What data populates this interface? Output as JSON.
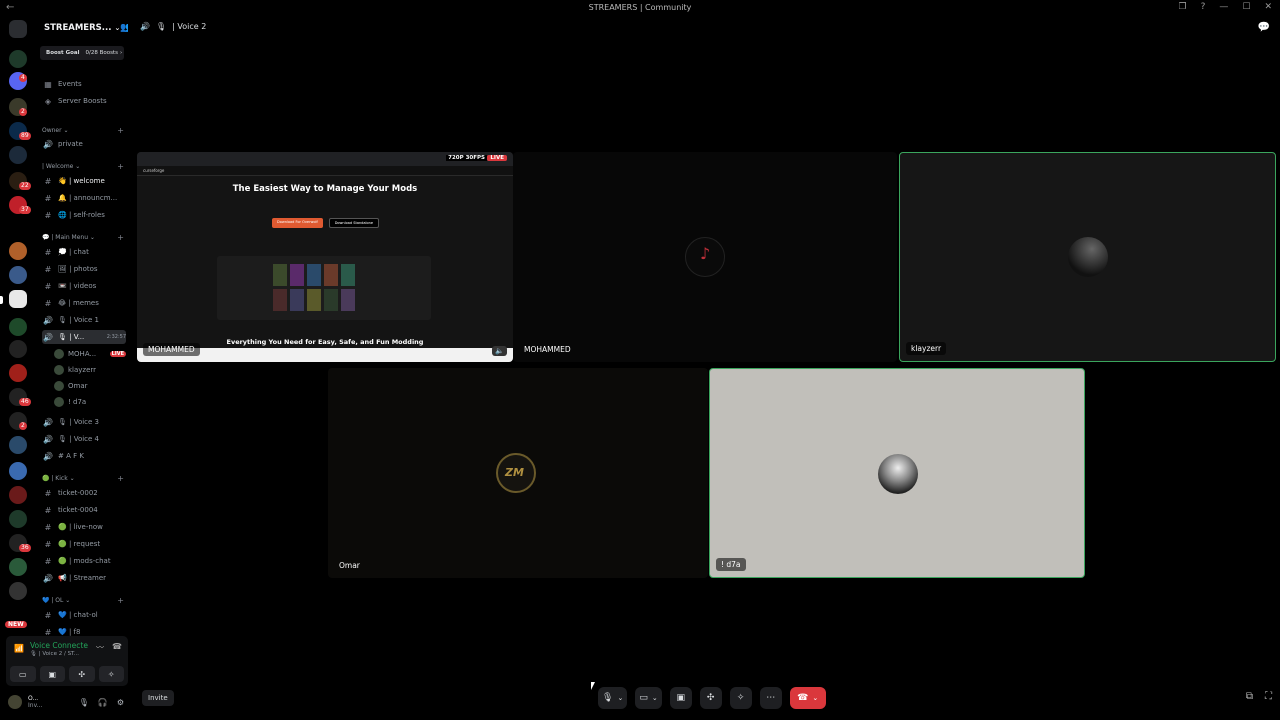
{
  "window": {
    "title": "STREAMERS | Community",
    "controls": [
      "❐",
      "?",
      "—",
      "☐",
      "✕"
    ]
  },
  "server": {
    "name": "STREAMERS...",
    "boost_goal_label": "Boost Goal",
    "boost_progress": "0/28 Boosts"
  },
  "rail": {
    "badges": [
      "4",
      "2",
      "89",
      "22",
      "37",
      "46",
      "2",
      "36"
    ],
    "new_label": "NEW"
  },
  "sidebar": {
    "items": [
      {
        "icon": "calendar-icon",
        "glyph": "▦",
        "label": "Events"
      },
      {
        "icon": "boost-icon",
        "glyph": "◈",
        "label": "Server Boosts"
      },
      {
        "icon": "",
        "glyph": "",
        "label": "Owner ⌄",
        "type": "cat"
      },
      {
        "icon": "speaker-icon",
        "glyph": "🔊",
        "label": "private"
      },
      {
        "icon": "",
        "glyph": "",
        "label": "| Welcome ⌄",
        "type": "cat"
      },
      {
        "icon": "hash-icon",
        "glyph": "#",
        "label": "👋 | welcome",
        "bright": true
      },
      {
        "icon": "hash-icon",
        "glyph": "#",
        "label": "🔔 | announcm..."
      },
      {
        "icon": "hash-icon",
        "glyph": "#",
        "label": "🌐 | self-roles"
      },
      {
        "icon": "",
        "glyph": "",
        "label": "💬 | Main Menu ⌄",
        "type": "cat"
      },
      {
        "icon": "hash-icon",
        "glyph": "#",
        "label": "💭 | chat"
      },
      {
        "icon": "hash-icon",
        "glyph": "#",
        "label": "🖼 | photos"
      },
      {
        "icon": "hash-icon",
        "glyph": "#",
        "label": "📼 | videos"
      },
      {
        "icon": "hash-icon",
        "glyph": "#",
        "label": "😂 | memes"
      },
      {
        "icon": "speaker-icon",
        "glyph": "🔊",
        "label": "🎙 | Voice 1"
      },
      {
        "icon": "speaker-icon",
        "glyph": "🔊",
        "label": "🎙 | V...",
        "active": true,
        "timer": "2:32:57"
      },
      {
        "icon": "",
        "glyph": "",
        "label": "MOHA...",
        "type": "user",
        "live": "LIVE"
      },
      {
        "icon": "",
        "glyph": "",
        "label": "klayzerr",
        "type": "user"
      },
      {
        "icon": "",
        "glyph": "",
        "label": "Omar",
        "type": "user"
      },
      {
        "icon": "",
        "glyph": "",
        "label": "! d7a",
        "type": "user"
      },
      {
        "icon": "speaker-icon",
        "glyph": "🔊",
        "label": "🎙 | Voice 3"
      },
      {
        "icon": "speaker-icon",
        "glyph": "🔊",
        "label": "🎙 | Voice 4"
      },
      {
        "icon": "speaker-icon",
        "glyph": "🔊",
        "label": "# A F K"
      },
      {
        "icon": "",
        "glyph": "",
        "label": "🟢 | Kick ⌄",
        "type": "cat"
      },
      {
        "icon": "hash-icon",
        "glyph": "#",
        "label": "ticket-0002"
      },
      {
        "icon": "hash-icon",
        "glyph": "#",
        "label": "ticket-0004"
      },
      {
        "icon": "hash-icon",
        "glyph": "#",
        "label": "🟢 | live-now"
      },
      {
        "icon": "hash-icon",
        "glyph": "#",
        "label": "🟢 | request"
      },
      {
        "icon": "hash-icon",
        "glyph": "#",
        "label": "🟢 | mods-chat"
      },
      {
        "icon": "speaker-icon",
        "glyph": "🔊",
        "label": "📢 | Streamer"
      },
      {
        "icon": "",
        "glyph": "",
        "label": "💙 | OL ⌄",
        "type": "cat"
      },
      {
        "icon": "hash-icon",
        "glyph": "#",
        "label": "💙 | chat-ol"
      },
      {
        "icon": "hash-icon",
        "glyph": "#",
        "label": "💙 | f8"
      }
    ]
  },
  "voice_panel": {
    "status": "Voice Connecte",
    "channel": "🎙 | Voice 2 / ST..."
  },
  "user_panel": {
    "name": "O...",
    "status": "Inv..."
  },
  "stage": {
    "channel_label": "| Voice 2",
    "tiles": [
      {
        "name": "MOHAMMED",
        "type": "screenshare"
      },
      {
        "name": "MOHAMMED",
        "type": "camera"
      },
      {
        "name": "klayzerr",
        "type": "camera",
        "speaking": true
      },
      {
        "name": "Omar",
        "type": "camera"
      },
      {
        "name": "! d7a",
        "type": "camera",
        "speaking": true
      }
    ],
    "screenshare": {
      "resolution": "720P 30FPS",
      "live": "LIVE",
      "brand": "curseforge",
      "headline": "The Easiest Way to Manage Your Mods",
      "primary_btn": "Download For Overwolf",
      "secondary_btn": "Download Standalone",
      "subline": "Everything You Need for Easy, Safe, and Fun Modding"
    }
  },
  "bottom": {
    "invite_label": "Invite"
  },
  "colors": {
    "accent_green": "#3ba55d",
    "danger": "#da373c",
    "brand": "#5865f2"
  }
}
